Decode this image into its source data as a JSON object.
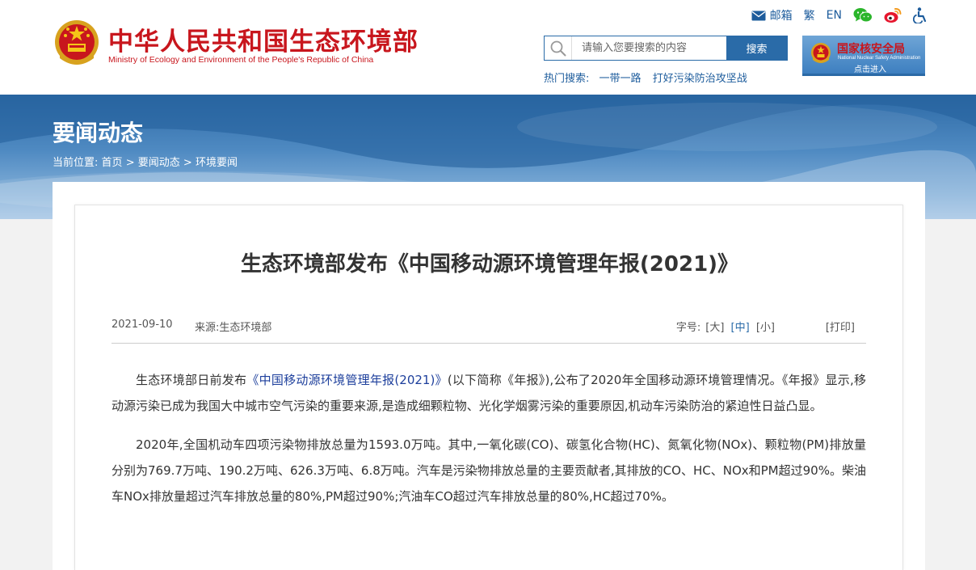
{
  "header": {
    "logo_cn": "中华人民共和国生态环境部",
    "logo_en": "Ministry of Ecology and Environment of the People's Republic of China",
    "top_links": {
      "mail": "邮箱",
      "traditional": "繁",
      "english": "EN"
    },
    "icons": [
      "mail-icon",
      "wechat-icon",
      "weibo-icon",
      "accessibility-icon",
      "search-icon"
    ],
    "search": {
      "placeholder": "请输入您要搜索的内容",
      "button": "搜索"
    },
    "hot_search": {
      "label": "热门搜索:",
      "items": [
        "一带一路",
        "打好污染防治攻坚战"
      ]
    },
    "nnsa": {
      "name_cn": "国家核安全局",
      "name_en": "National Nuclear Safety Administration",
      "enter": "点击进入"
    }
  },
  "banner": {
    "title": "要闻动态",
    "breadcrumb": {
      "label": "当前位置:",
      "items": [
        "首页",
        "要闻动态",
        "环境要闻"
      ],
      "separator": ">"
    }
  },
  "article": {
    "title": "生态环境部发布《中国移动源环境管理年报(2021)》",
    "date": "2021-09-10",
    "source": "来源:生态环境部",
    "font_size": {
      "label": "字号:",
      "large": "[大]",
      "medium": "[中]",
      "small": "[小]"
    },
    "print": "[打印]",
    "paragraphs": [
      {
        "before": "生态环境部日前发布",
        "link": "《中国移动源环境管理年报(2021)》",
        "after": "(以下简称《年报》),公布了2020年全国移动源环境管理情况。《年报》显示,移动源污染已成为我国大中城市空气污染的重要来源,是造成细颗粒物、光化学烟雾污染的重要原因,机动车污染防治的紧迫性日益凸显。"
      },
      {
        "text": "2020年,全国机动车四项污染物排放总量为1593.0万吨。其中,一氧化碳(CO)、碳氢化合物(HC)、氮氧化物(NOx)、颗粒物(PM)排放量分别为769.7万吨、190.2万吨、626.3万吨、6.8万吨。汽车是污染物排放总量的主要贡献者,其排放的CO、HC、NOx和PM超过90%。柴油车NOx排放量超过汽车排放总量的80%,PM超过90%;汽油车CO超过汽车排放总量的80%,HC超过70%。"
      }
    ]
  },
  "colors": {
    "brand_red": "#c8161d",
    "link_blue": "#1d5c9c",
    "button_blue": "#2a6ba8"
  }
}
